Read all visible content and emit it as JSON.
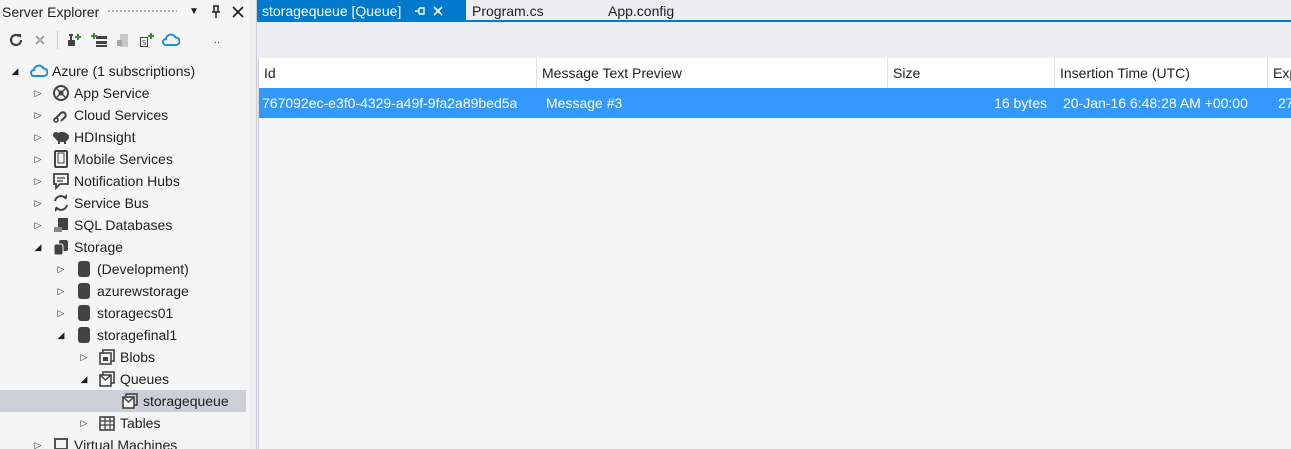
{
  "server_explorer": {
    "title": "Server Explorer",
    "header_buttons": {
      "dropdown": "▼",
      "pin": "pin-icon",
      "close": "close-icon"
    },
    "toolbar": [
      "refresh-icon",
      "stop-icon",
      "connect-to-server-icon",
      "add-connection-icon",
      "connect-to-database-icon",
      "sharepoint-icon",
      "azure-connect-icon"
    ],
    "tree": [
      {
        "label": "Azure (1 subscriptions)",
        "icon": "azure-cloud-icon",
        "expanded": true
      },
      {
        "label": "App Service",
        "icon": "app-service-icon"
      },
      {
        "label": "Cloud Services",
        "icon": "cloud-services-icon"
      },
      {
        "label": "HDInsight",
        "icon": "hdinsight-icon"
      },
      {
        "label": "Mobile Services",
        "icon": "mobile-services-icon"
      },
      {
        "label": "Notification Hubs",
        "icon": "notification-hubs-icon"
      },
      {
        "label": "Service Bus",
        "icon": "service-bus-icon"
      },
      {
        "label": "SQL Databases",
        "icon": "sql-databases-icon"
      },
      {
        "label": "Storage",
        "icon": "storage-icon",
        "expanded": true
      },
      {
        "label": "(Development)",
        "icon": "storage-account-icon"
      },
      {
        "label": "azurewstorage",
        "icon": "storage-account-icon"
      },
      {
        "label": "storagecs01",
        "icon": "storage-account-icon"
      },
      {
        "label": "storagefinal1",
        "icon": "storage-account-icon",
        "expanded": true
      },
      {
        "label": "Blobs",
        "icon": "blobs-icon"
      },
      {
        "label": "Queues",
        "icon": "queues-icon",
        "expanded": true
      },
      {
        "label": "storagequeue",
        "icon": "queue-icon",
        "selected": true
      },
      {
        "label": "Tables",
        "icon": "tables-icon"
      },
      {
        "label": "Virtual Machines",
        "icon": "virtual-machines-icon"
      }
    ]
  },
  "tabs": [
    {
      "label": "storagequeue [Queue]",
      "active": true
    },
    {
      "label": "Program.cs"
    },
    {
      "label": "App.config"
    }
  ],
  "queue_grid": {
    "columns": [
      "Id",
      "Message Text Preview",
      "Size",
      "Insertion Time (UTC)",
      "Exp"
    ],
    "rows": [
      {
        "id": "767092ec-e3f0-4329-a49f-9fa2a89bed5a",
        "message": "Message #3",
        "size": "16 bytes",
        "insertion_time": "20-Jan-16 6:48:28 AM +00:00",
        "expiration": "27"
      }
    ]
  },
  "colors": {
    "accent": "#007acc",
    "selection": "#3399ff",
    "tree_selection": "#ccced8"
  }
}
